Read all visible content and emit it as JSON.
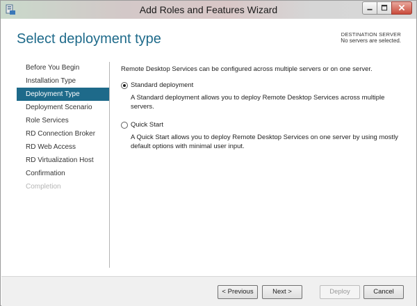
{
  "window": {
    "title": "Add Roles and Features Wizard",
    "controls": {
      "minimize_icon": "minimize-icon",
      "maximize_icon": "maximize-icon",
      "close_icon": "close-icon"
    }
  },
  "header": {
    "page_title": "Select deployment type",
    "destination_label": "DESTINATION SERVER",
    "destination_value": "No servers are selected."
  },
  "nav": {
    "items": [
      {
        "label": "Before You Begin",
        "state": "normal"
      },
      {
        "label": "Installation Type",
        "state": "normal"
      },
      {
        "label": "Deployment Type",
        "state": "active"
      },
      {
        "label": "Deployment Scenario",
        "state": "normal"
      },
      {
        "label": "Role Services",
        "state": "normal"
      },
      {
        "label": "RD Connection Broker",
        "state": "normal"
      },
      {
        "label": "RD Web Access",
        "state": "normal"
      },
      {
        "label": "RD Virtualization Host",
        "state": "normal"
      },
      {
        "label": "Confirmation",
        "state": "normal"
      },
      {
        "label": "Completion",
        "state": "disabled"
      }
    ]
  },
  "content": {
    "intro": "Remote Desktop Services can be configured across multiple servers or on one server.",
    "options": [
      {
        "label": "Standard deployment",
        "description": "A Standard deployment allows you to deploy Remote Desktop Services across multiple servers.",
        "selected": true
      },
      {
        "label": "Quick Start",
        "description": "A Quick Start allows you to deploy Remote Desktop Services on one server by using mostly default options with minimal user input.",
        "selected": false
      }
    ]
  },
  "footer": {
    "previous_label": "< Previous",
    "next_label": "Next >",
    "deploy_label": "Deploy",
    "cancel_label": "Cancel"
  },
  "colors": {
    "accent": "#1e6a8a",
    "active_nav_bg": "#1e6a8a",
    "disabled_text": "#b5b5b5"
  }
}
